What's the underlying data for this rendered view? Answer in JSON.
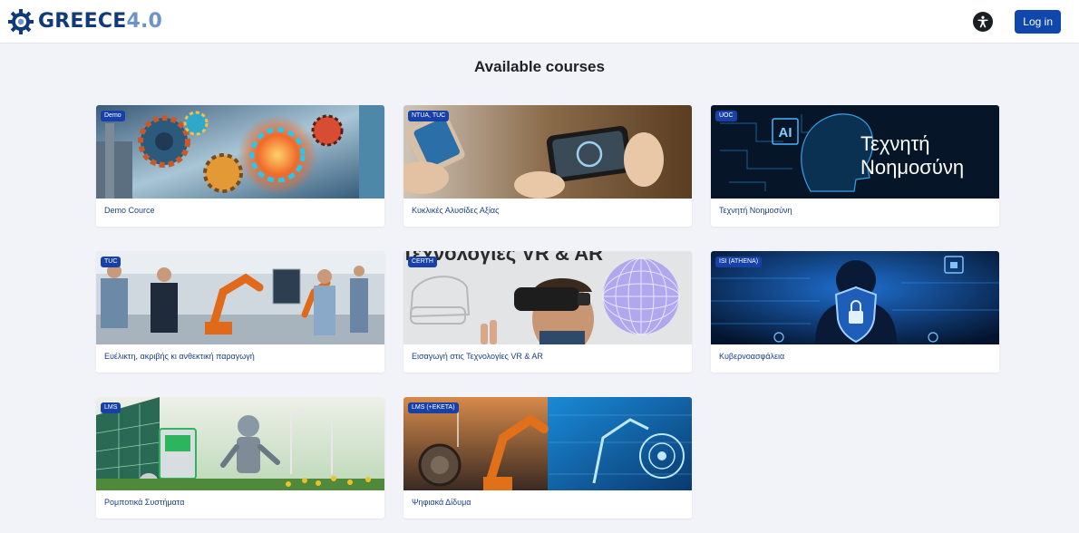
{
  "brand": {
    "name_main": "GREECE",
    "name_version": "4.0"
  },
  "nav": {
    "login_label": "Log in"
  },
  "page": {
    "title": "Available courses"
  },
  "courses": [
    {
      "badge": "Demo",
      "title": "Demo Cource"
    },
    {
      "badge": "NTUA, TUC",
      "title": "Κυκλικές Αλυσίδες Αξίας"
    },
    {
      "badge": "UOC",
      "title": "Τεχνητή Νοημοσύνη",
      "image_text_line1": "Τεχνητή",
      "image_text_line2": "Νοημοσύνη",
      "image_ai_label": "AI"
    },
    {
      "badge": "TUC",
      "title": "Ευέλικτη, ακριβής κι ανθεκτική παραγωγή"
    },
    {
      "badge": "CERTH",
      "title": "Εισαγωγή στις Τεχνολογίες VR & AR",
      "image_banner": "Τεχνολογίες VR & AR"
    },
    {
      "badge": "ISI (ATHENA)",
      "title": "Κυβερνοασφάλεια"
    },
    {
      "badge": "LMS",
      "title": "Ρομποτικά Συστήματα"
    },
    {
      "badge": "LMS (+EKETA)",
      "title": "Ψηφιακά Δίδυμα"
    }
  ],
  "colors": {
    "primary": "#0f47ad",
    "badge": "#1741a8",
    "link": "#1a3f86",
    "background": "#f1f3f8",
    "brand_dark": "#103a7a",
    "brand_light": "#6b94c9"
  }
}
